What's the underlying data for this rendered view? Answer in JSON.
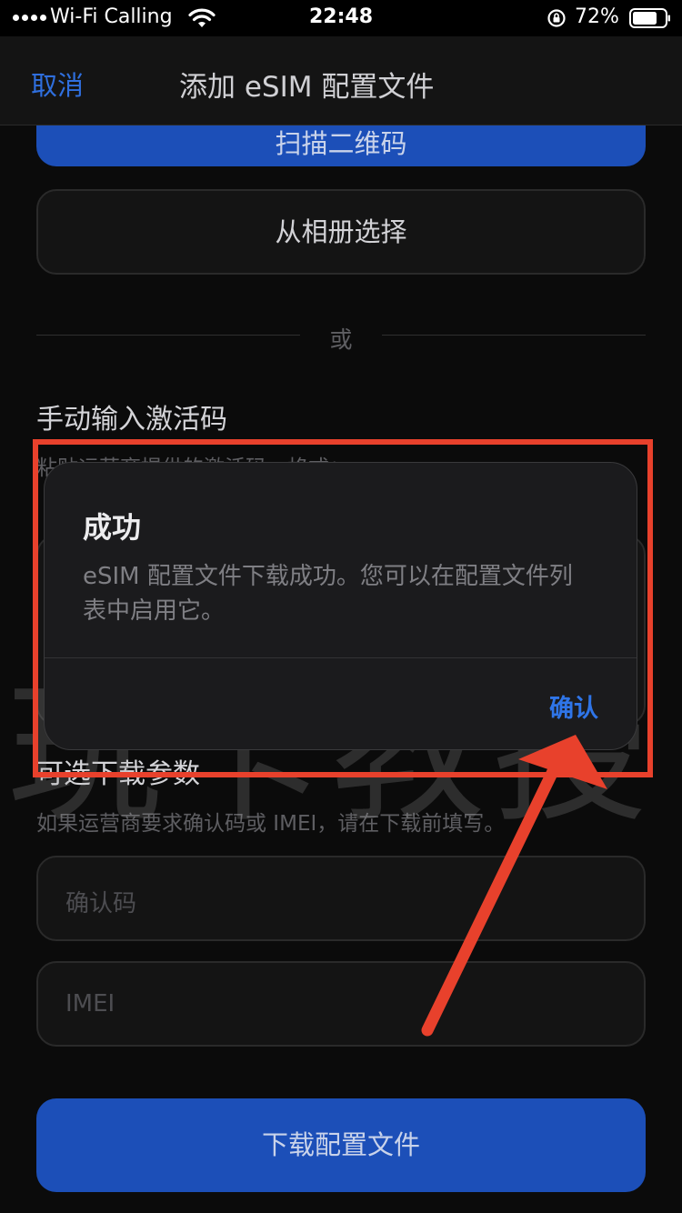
{
  "status_bar": {
    "carrier": "Wi-Fi Calling",
    "time": "22:48",
    "battery": "72%"
  },
  "nav": {
    "cancel": "取消",
    "title": "添加 eSIM 配置文件"
  },
  "content": {
    "scan_button": "扫描二维码",
    "album_button": "从相册选择",
    "divider": "或",
    "manual_title": "手动输入激活码",
    "manual_desc": "粘贴运营商提供的激活码，格式：",
    "optional_title": "可选下载参数",
    "optional_desc": "如果运营商要求确认码或 IMEI，请在下载前填写。",
    "confirmation_code_placeholder": "确认码",
    "imei_placeholder": "IMEI",
    "download_button": "下载配置文件"
  },
  "dialog": {
    "title": "成功",
    "message": "eSIM 配置文件下载成功。您可以在配置文件列表中启用它。",
    "confirm": "确认"
  },
  "watermark": "玩卡教授",
  "colors": {
    "accent_blue": "#1c4fb8",
    "link_blue": "#2f75e8",
    "annotation_red": "#e8412c"
  }
}
